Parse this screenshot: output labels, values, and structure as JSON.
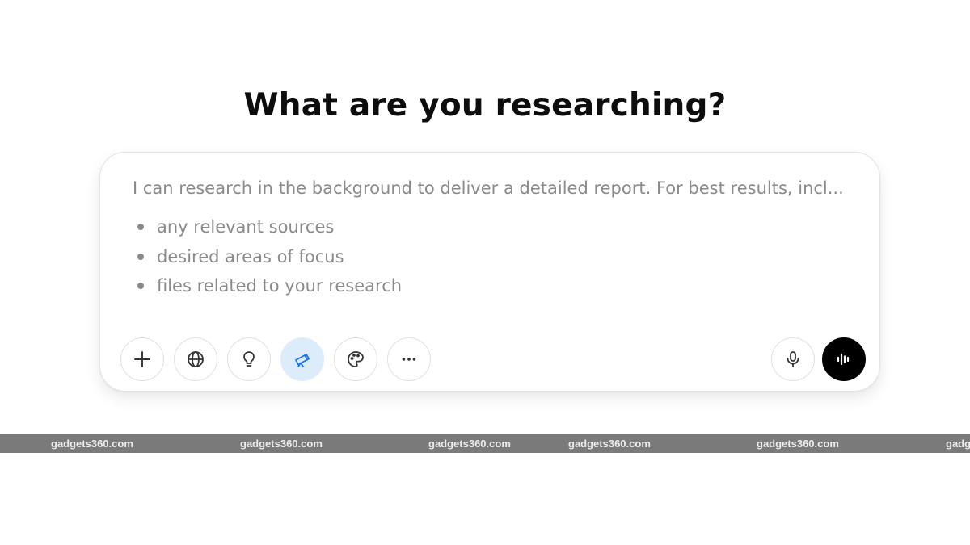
{
  "heading": "What are you researching?",
  "composer": {
    "placeholder_intro": "I can research in the background to deliver a detailed report. For best results, incl...",
    "placeholder_items": [
      "any relevant sources",
      "desired areas of focus",
      "files related to your research"
    ]
  },
  "toolbar": {
    "buttons": [
      {
        "name": "add-button",
        "icon": "plus-icon"
      },
      {
        "name": "search-web-button",
        "icon": "globe-icon"
      },
      {
        "name": "reason-button",
        "icon": "lightbulb-icon"
      },
      {
        "name": "deep-research-button",
        "icon": "telescope-icon",
        "active": true
      },
      {
        "name": "create-image-button",
        "icon": "palette-icon"
      },
      {
        "name": "more-tools-button",
        "icon": "more-horizontal-icon"
      }
    ],
    "right": [
      {
        "name": "dictate-button",
        "icon": "microphone-icon"
      },
      {
        "name": "voice-mode-button",
        "icon": "voice-waveform-icon"
      }
    ],
    "active_color": "#dcecfb",
    "active_icon_color": "#1a73e8"
  },
  "watermark": {
    "text": "gadgets360.com",
    "text_truncated": "gadg"
  }
}
